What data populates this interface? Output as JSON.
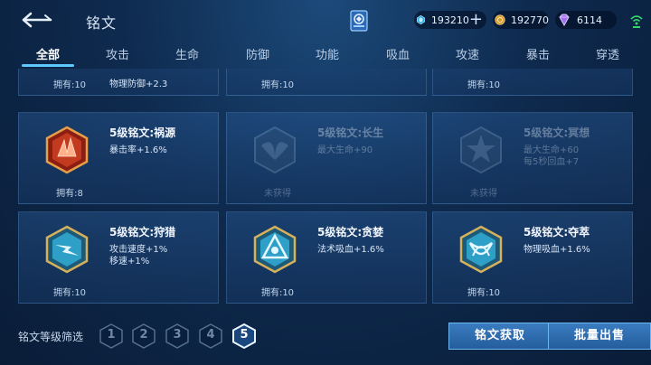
{
  "header": {
    "title": "铭文",
    "currencies": [
      {
        "icon": "crystal-icon",
        "value": "193210",
        "color": "#6fd0ff"
      },
      {
        "icon": "gold-coin-icon",
        "value": "192770",
        "color": "#e7b54a"
      },
      {
        "icon": "gem-icon",
        "value": "6114",
        "color": "#c18cff"
      }
    ]
  },
  "tabs": [
    {
      "label": "全部",
      "active": true
    },
    {
      "label": "攻击"
    },
    {
      "label": "生命"
    },
    {
      "label": "防御"
    },
    {
      "label": "功能"
    },
    {
      "label": "吸血"
    },
    {
      "label": "攻速"
    },
    {
      "label": "暴击"
    },
    {
      "label": "穿透"
    }
  ],
  "cards": [
    {
      "name": "",
      "attrs": [
        "物理防御+2.3"
      ],
      "owned": "拥有:10",
      "locked": false,
      "partial": true
    },
    {
      "name": "",
      "attrs": [],
      "owned": "拥有:10",
      "locked": false,
      "partial": true
    },
    {
      "name": "",
      "attrs": [],
      "owned": "拥有:10",
      "locked": false,
      "partial": true
    },
    {
      "name": "5级铭文:祸源",
      "attrs": [
        "暴击率+1.6%"
      ],
      "owned": "拥有:8",
      "locked": false,
      "emblem": "red-crystal-emblem",
      "color": "#d8492a"
    },
    {
      "name": "5级铭文:长生",
      "attrs": [
        "最大生命+90"
      ],
      "owned": "未获得",
      "locked": true,
      "emblem": "wing-emblem",
      "color": "#6a8aa8"
    },
    {
      "name": "5级铭文:冥想",
      "attrs": [
        "最大生命+60",
        "每5秒回血+7"
      ],
      "owned": "未获得",
      "locked": true,
      "emblem": "star-emblem",
      "color": "#6a8aa8"
    },
    {
      "name": "5级铭文:狩猎",
      "attrs": [
        "攻击速度+1%",
        "移速+1%"
      ],
      "owned": "拥有:10",
      "locked": false,
      "emblem": "lightning-emblem",
      "color": "#3fb8d8"
    },
    {
      "name": "5级铭文:贪婪",
      "attrs": [
        "法术吸血+1.6%"
      ],
      "owned": "拥有:10",
      "locked": false,
      "emblem": "triangle-emblem",
      "color": "#3fb8d8"
    },
    {
      "name": "5级铭文:夺萃",
      "attrs": [
        "物理吸血+1.6%"
      ],
      "owned": "拥有:10",
      "locked": false,
      "emblem": "knot-emblem",
      "color": "#3fb8d8"
    }
  ],
  "footer": {
    "filter_label": "铭文等级筛选",
    "levels": [
      "1",
      "2",
      "3",
      "4",
      "5"
    ],
    "active_level": "5",
    "get_button": "铭文获取",
    "sell_button": "批量出售"
  }
}
